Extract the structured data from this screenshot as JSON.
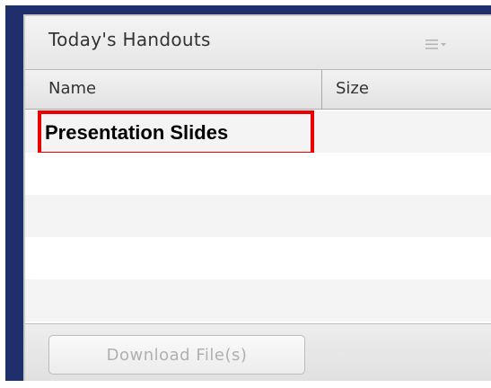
{
  "panel": {
    "title": "Today's Handouts",
    "menu_icon": "list-menu-icon"
  },
  "table": {
    "columns": [
      "Name",
      "Size"
    ],
    "rows": [
      {
        "name": "Presentation Slides",
        "size": ""
      },
      {
        "name": "",
        "size": ""
      },
      {
        "name": "",
        "size": ""
      },
      {
        "name": "",
        "size": ""
      },
      {
        "name": "",
        "size": ""
      }
    ]
  },
  "footer": {
    "download_label": "Download File(s)",
    "download_enabled": false
  },
  "colors": {
    "frame": "#1f2f6b",
    "highlight": "#ee0000",
    "header_text": "#333333",
    "disabled_text": "#b0b0b0"
  }
}
